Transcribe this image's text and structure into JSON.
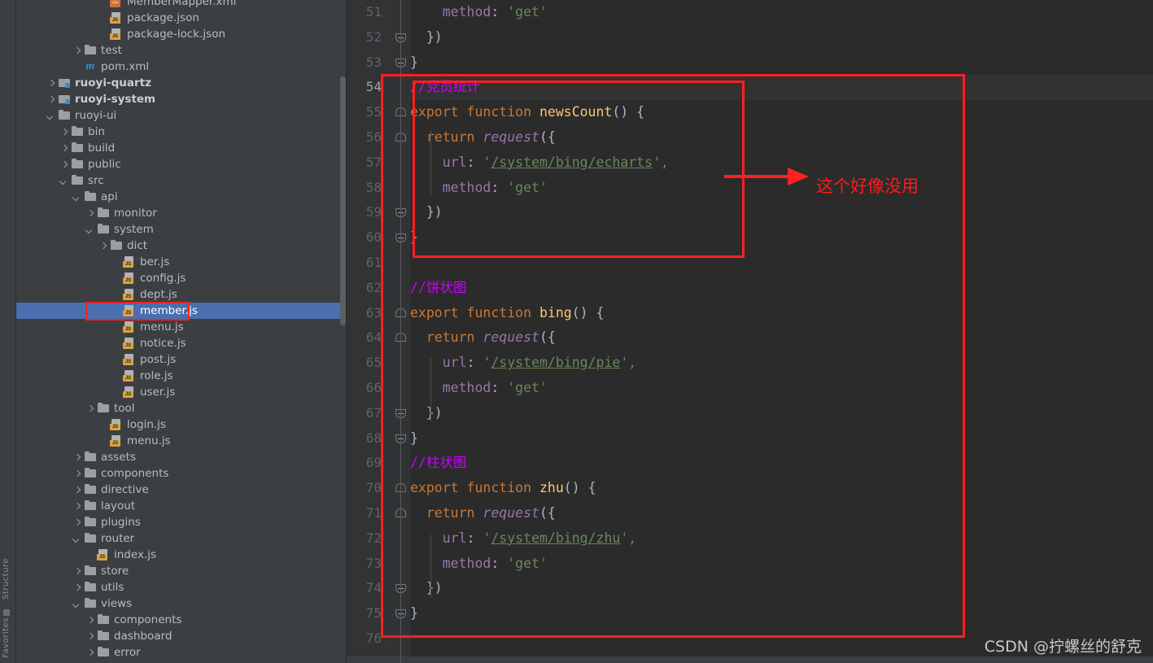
{
  "toolstrip": {
    "labels": [
      "Structure",
      "Favorites"
    ]
  },
  "project_tree": {
    "scrollbar": "vertical-scrollbar",
    "items": [
      {
        "label": "MemberMapper.xml",
        "icon": "xml-file-icon",
        "indent": 6,
        "arrow": "none",
        "bold": false,
        "selected": false
      },
      {
        "label": "package.json",
        "icon": "json-file-icon",
        "indent": 6,
        "arrow": "none",
        "bold": false,
        "selected": false
      },
      {
        "label": "package-lock.json",
        "icon": "json-file-icon",
        "indent": 6,
        "arrow": "none",
        "bold": false,
        "selected": false
      },
      {
        "label": "test",
        "icon": "folder-icon",
        "indent": 4,
        "arrow": "right",
        "bold": false,
        "selected": false
      },
      {
        "label": "pom.xml",
        "icon": "maven-icon",
        "indent": 4,
        "arrow": "none",
        "bold": false,
        "selected": false
      },
      {
        "label": "ruoyi-quartz",
        "icon": "module-icon",
        "indent": 2,
        "arrow": "right",
        "bold": true,
        "selected": false
      },
      {
        "label": "ruoyi-system",
        "icon": "module-icon",
        "indent": 2,
        "arrow": "right",
        "bold": true,
        "selected": false
      },
      {
        "label": "ruoyi-ui",
        "icon": "folder-icon",
        "indent": 2,
        "arrow": "down",
        "bold": false,
        "selected": false
      },
      {
        "label": "bin",
        "icon": "folder-icon",
        "indent": 3,
        "arrow": "right",
        "bold": false,
        "selected": false
      },
      {
        "label": "build",
        "icon": "folder-icon",
        "indent": 3,
        "arrow": "right",
        "bold": false,
        "selected": false
      },
      {
        "label": "public",
        "icon": "folder-icon",
        "indent": 3,
        "arrow": "right",
        "bold": false,
        "selected": false
      },
      {
        "label": "src",
        "icon": "folder-icon",
        "indent": 3,
        "arrow": "down",
        "bold": false,
        "selected": false
      },
      {
        "label": "api",
        "icon": "folder-icon",
        "indent": 4,
        "arrow": "down",
        "bold": false,
        "selected": false
      },
      {
        "label": "monitor",
        "icon": "folder-icon",
        "indent": 5,
        "arrow": "right",
        "bold": false,
        "selected": false
      },
      {
        "label": "system",
        "icon": "folder-icon",
        "indent": 5,
        "arrow": "down",
        "bold": false,
        "selected": false
      },
      {
        "label": "dict",
        "icon": "folder-icon",
        "indent": 6,
        "arrow": "right",
        "bold": false,
        "selected": false
      },
      {
        "label": "ber.js",
        "icon": "js-file-icon",
        "indent": 7,
        "arrow": "none",
        "bold": false,
        "selected": false
      },
      {
        "label": "config.js",
        "icon": "js-file-icon",
        "indent": 7,
        "arrow": "none",
        "bold": false,
        "selected": false
      },
      {
        "label": "dept.js",
        "icon": "js-file-icon",
        "indent": 7,
        "arrow": "none",
        "bold": false,
        "selected": false
      },
      {
        "label": "member.js",
        "icon": "js-file-icon",
        "indent": 7,
        "arrow": "none",
        "bold": false,
        "selected": true
      },
      {
        "label": "menu.js",
        "icon": "js-file-icon",
        "indent": 7,
        "arrow": "none",
        "bold": false,
        "selected": false
      },
      {
        "label": "notice.js",
        "icon": "js-file-icon",
        "indent": 7,
        "arrow": "none",
        "bold": false,
        "selected": false
      },
      {
        "label": "post.js",
        "icon": "js-file-icon",
        "indent": 7,
        "arrow": "none",
        "bold": false,
        "selected": false
      },
      {
        "label": "role.js",
        "icon": "js-file-icon",
        "indent": 7,
        "arrow": "none",
        "bold": false,
        "selected": false
      },
      {
        "label": "user.js",
        "icon": "js-file-icon",
        "indent": 7,
        "arrow": "none",
        "bold": false,
        "selected": false
      },
      {
        "label": "tool",
        "icon": "folder-icon",
        "indent": 5,
        "arrow": "right",
        "bold": false,
        "selected": false
      },
      {
        "label": "login.js",
        "icon": "js-file-icon",
        "indent": 6,
        "arrow": "none",
        "bold": false,
        "selected": false
      },
      {
        "label": "menu.js",
        "icon": "js-file-icon",
        "indent": 6,
        "arrow": "none",
        "bold": false,
        "selected": false
      },
      {
        "label": "assets",
        "icon": "folder-icon",
        "indent": 4,
        "arrow": "right",
        "bold": false,
        "selected": false
      },
      {
        "label": "components",
        "icon": "folder-icon",
        "indent": 4,
        "arrow": "right",
        "bold": false,
        "selected": false
      },
      {
        "label": "directive",
        "icon": "folder-icon",
        "indent": 4,
        "arrow": "right",
        "bold": false,
        "selected": false
      },
      {
        "label": "layout",
        "icon": "folder-icon",
        "indent": 4,
        "arrow": "right",
        "bold": false,
        "selected": false
      },
      {
        "label": "plugins",
        "icon": "folder-icon",
        "indent": 4,
        "arrow": "right",
        "bold": false,
        "selected": false
      },
      {
        "label": "router",
        "icon": "folder-icon",
        "indent": 4,
        "arrow": "down",
        "bold": false,
        "selected": false
      },
      {
        "label": "index.js",
        "icon": "js-file-icon",
        "indent": 5,
        "arrow": "none",
        "bold": false,
        "selected": false
      },
      {
        "label": "store",
        "icon": "folder-icon",
        "indent": 4,
        "arrow": "right",
        "bold": false,
        "selected": false
      },
      {
        "label": "utils",
        "icon": "folder-icon",
        "indent": 4,
        "arrow": "right",
        "bold": false,
        "selected": false
      },
      {
        "label": "views",
        "icon": "folder-icon",
        "indent": 4,
        "arrow": "down",
        "bold": false,
        "selected": false
      },
      {
        "label": "components",
        "icon": "folder-icon",
        "indent": 5,
        "arrow": "right",
        "bold": false,
        "selected": false
      },
      {
        "label": "dashboard",
        "icon": "folder-icon",
        "indent": 5,
        "arrow": "right",
        "bold": false,
        "selected": false
      },
      {
        "label": "error",
        "icon": "folder-icon",
        "indent": 5,
        "arrow": "right",
        "bold": false,
        "selected": false
      }
    ]
  },
  "editor": {
    "first_line_number": 51,
    "current_line_number": 54,
    "lines": [
      {
        "n": 51,
        "tokens": [
          {
            "t": "    ",
            "c": "id"
          },
          {
            "t": "method",
            "c": "pk"
          },
          {
            "t": ": ",
            "c": "id"
          },
          {
            "t": "'get'",
            "c": "st"
          }
        ],
        "fold": "none"
      },
      {
        "n": 52,
        "tokens": [
          {
            "t": "  })",
            "c": "id"
          }
        ],
        "fold": "close"
      },
      {
        "n": 53,
        "tokens": [
          {
            "t": "}",
            "c": "id"
          }
        ],
        "fold": "close"
      },
      {
        "n": 54,
        "tokens": [
          {
            "t": "//党员统计",
            "c": "cm"
          }
        ],
        "fold": "none"
      },
      {
        "n": 55,
        "tokens": [
          {
            "t": "export function ",
            "c": "k"
          },
          {
            "t": "newsCount",
            "c": "fn"
          },
          {
            "t": "() {",
            "c": "id"
          }
        ],
        "fold": "open"
      },
      {
        "n": 56,
        "tokens": [
          {
            "t": "  ",
            "c": "id"
          },
          {
            "t": "return ",
            "c": "k"
          },
          {
            "t": "request",
            "c": "pr"
          },
          {
            "t": "({",
            "c": "id"
          }
        ],
        "fold": "open"
      },
      {
        "n": 57,
        "tokens": [
          {
            "t": "    ",
            "c": "id"
          },
          {
            "t": "url",
            "c": "pk"
          },
          {
            "t": ": ",
            "c": "id"
          },
          {
            "t": "'",
            "c": "st"
          },
          {
            "t": "/system/bing/echarts",
            "c": "url"
          },
          {
            "t": "',",
            "c": "st"
          }
        ],
        "fold": "none"
      },
      {
        "n": 58,
        "tokens": [
          {
            "t": "    ",
            "c": "id"
          },
          {
            "t": "method",
            "c": "pk"
          },
          {
            "t": ": ",
            "c": "id"
          },
          {
            "t": "'get'",
            "c": "st"
          }
        ],
        "fold": "none"
      },
      {
        "n": 59,
        "tokens": [
          {
            "t": "  })",
            "c": "id"
          }
        ],
        "fold": "close"
      },
      {
        "n": 60,
        "tokens": [
          {
            "t": "}",
            "c": "id"
          }
        ],
        "fold": "close"
      },
      {
        "n": 61,
        "tokens": [],
        "fold": "none"
      },
      {
        "n": 62,
        "tokens": [
          {
            "t": "//饼状图",
            "c": "cm"
          }
        ],
        "fold": "none"
      },
      {
        "n": 63,
        "tokens": [
          {
            "t": "export function ",
            "c": "k"
          },
          {
            "t": "bing",
            "c": "fn"
          },
          {
            "t": "() {",
            "c": "id"
          }
        ],
        "fold": "open"
      },
      {
        "n": 64,
        "tokens": [
          {
            "t": "  ",
            "c": "id"
          },
          {
            "t": "return ",
            "c": "k"
          },
          {
            "t": "request",
            "c": "pr"
          },
          {
            "t": "({",
            "c": "id"
          }
        ],
        "fold": "open"
      },
      {
        "n": 65,
        "tokens": [
          {
            "t": "    ",
            "c": "id"
          },
          {
            "t": "url",
            "c": "pk"
          },
          {
            "t": ": ",
            "c": "id"
          },
          {
            "t": "'",
            "c": "st"
          },
          {
            "t": "/system/bing/pie",
            "c": "url"
          },
          {
            "t": "',",
            "c": "st"
          }
        ],
        "fold": "none"
      },
      {
        "n": 66,
        "tokens": [
          {
            "t": "    ",
            "c": "id"
          },
          {
            "t": "method",
            "c": "pk"
          },
          {
            "t": ": ",
            "c": "id"
          },
          {
            "t": "'get'",
            "c": "st"
          }
        ],
        "fold": "none"
      },
      {
        "n": 67,
        "tokens": [
          {
            "t": "  })",
            "c": "id"
          }
        ],
        "fold": "close"
      },
      {
        "n": 68,
        "tokens": [
          {
            "t": "}",
            "c": "id"
          }
        ],
        "fold": "close"
      },
      {
        "n": 69,
        "tokens": [
          {
            "t": "//柱状图",
            "c": "cm"
          }
        ],
        "fold": "none"
      },
      {
        "n": 70,
        "tokens": [
          {
            "t": "export function ",
            "c": "k"
          },
          {
            "t": "zhu",
            "c": "fn"
          },
          {
            "t": "() {",
            "c": "id"
          }
        ],
        "fold": "open"
      },
      {
        "n": 71,
        "tokens": [
          {
            "t": "  ",
            "c": "id"
          },
          {
            "t": "return ",
            "c": "k"
          },
          {
            "t": "request",
            "c": "pr"
          },
          {
            "t": "({",
            "c": "id"
          }
        ],
        "fold": "open"
      },
      {
        "n": 72,
        "tokens": [
          {
            "t": "    ",
            "c": "id"
          },
          {
            "t": "url",
            "c": "pk"
          },
          {
            "t": ": ",
            "c": "id"
          },
          {
            "t": "'",
            "c": "st"
          },
          {
            "t": "/system/bing/zhu",
            "c": "url"
          },
          {
            "t": "',",
            "c": "st"
          }
        ],
        "fold": "none"
      },
      {
        "n": 73,
        "tokens": [
          {
            "t": "    ",
            "c": "id"
          },
          {
            "t": "method",
            "c": "pk"
          },
          {
            "t": ": ",
            "c": "id"
          },
          {
            "t": "'get'",
            "c": "st"
          }
        ],
        "fold": "none"
      },
      {
        "n": 74,
        "tokens": [
          {
            "t": "  })",
            "c": "id"
          }
        ],
        "fold": "close"
      },
      {
        "n": 75,
        "tokens": [
          {
            "t": "}",
            "c": "id"
          }
        ],
        "fold": "close"
      },
      {
        "n": 76,
        "tokens": [],
        "fold": "none"
      }
    ]
  },
  "annotation": {
    "color": "#ff2020",
    "note_text": "这个好像没用",
    "note_color": "#ff1a1a",
    "arrow_name": "red-arrow-pointing-right",
    "outer_box_name": "red-highlight-box-outer",
    "inner_box_name": "red-highlight-box-inner",
    "tree_box_name": "red-highlight-box-member-js"
  },
  "watermark": {
    "text": "CSDN @拧螺丝的舒克"
  },
  "colors": {
    "editor_bg": "#2b2b2b",
    "gutter_bg": "#313335",
    "sidebar_bg": "#3c3f41",
    "selection_blue": "#4b6eaf",
    "current_line": "#323232",
    "keyword_orange": "#cc7832",
    "function_yellow": "#ffc66d",
    "string_green": "#6a8759",
    "property_purple": "#9876aa",
    "comment_magenta": "#cc00ff"
  }
}
